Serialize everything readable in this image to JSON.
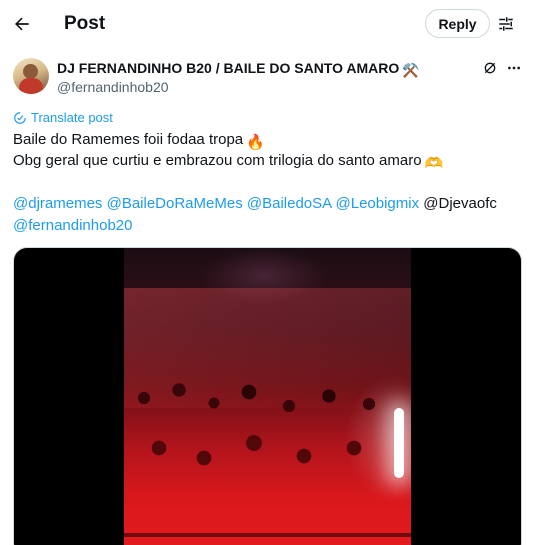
{
  "header": {
    "title": "Post",
    "reply_label": "Reply"
  },
  "author": {
    "display_name": "DJ FERNANDINHO B20 / BAILE DO SANTO AMARO",
    "name_emoji": "⚒️",
    "handle": "@fernandinhob20"
  },
  "translate_label": "Translate post",
  "post": {
    "line1": "Baile do Ramemes foii fodaa tropa",
    "line1_emoji": "🔥",
    "line2": "Obg geral que curtiu e embrazou com trilogia do santo amaro",
    "line2_emoji": "🫶",
    "mentions_line3": [
      "@djramemes",
      "@BaileDoRaMeMes",
      "@BailedoSA",
      "@Leobigmix"
    ],
    "plain_mention": "@Djevaofc",
    "mention_line4": "@fernandinhob20"
  },
  "colors": {
    "accent": "#1d9bf0",
    "text": "#0f1419",
    "secondary": "#536471",
    "border": "#cfd9de"
  },
  "icons": [
    "back-arrow-icon",
    "filter-icon",
    "grok-icon",
    "more-icon",
    "translate-icon"
  ]
}
